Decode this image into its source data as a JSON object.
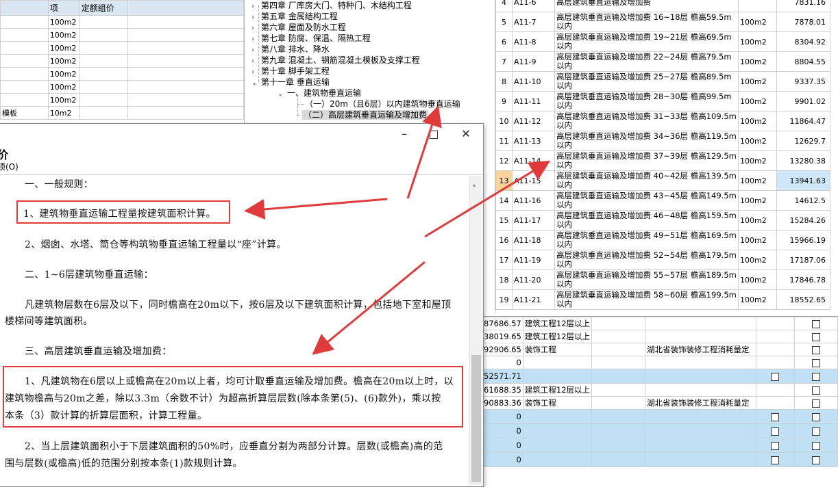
{
  "top_left_grid": {
    "headers": [
      "",
      "项",
      "定额组价"
    ],
    "rows": [
      {
        "name": "",
        "unit": "100m2"
      },
      {
        "name": "",
        "unit": "100m2"
      },
      {
        "name": "",
        "unit": "100m2"
      },
      {
        "name": "",
        "unit": "100m2"
      },
      {
        "name": "",
        "unit": "100m2"
      },
      {
        "name": "",
        "unit": "100m2"
      },
      {
        "name": "",
        "unit": "100m2"
      },
      {
        "name": "模板",
        "unit": "10m2"
      }
    ]
  },
  "tree": {
    "chapters": [
      "第四章  厂库房大门、特种门、木结构工程",
      "第五章  金属结构工程",
      "第六章  屋面及防水工程",
      "第七章  防腐、保温、隔热工程",
      "第八章  排水、降水",
      "第九章  混凝土、钢筋混凝土模板及支撑工程",
      "第十章  脚手架工程",
      "第十一章  垂直运输"
    ],
    "sub": "一、建筑物垂直运输",
    "leaf1": "（一）20m（且6层）以内建筑物垂直运输",
    "leaf2": "（二）高层建筑垂直运输及增加费"
  },
  "quota_table": {
    "rows": [
      {
        "num": "4",
        "code": "A11-6",
        "name": "高层建筑垂直运输及增加费",
        "unit": "",
        "price": "7831.16"
      },
      {
        "num": "5",
        "code": "A11-7",
        "name": "高层建筑垂直运输及增加费 16~18层 檐高59.5m以内",
        "unit": "100m2",
        "price": "7878.01"
      },
      {
        "num": "6",
        "code": "A11-8",
        "name": "高层建筑垂直运输及增加费 19~21层 檐高69.5m以内",
        "unit": "100m2",
        "price": "8304.92"
      },
      {
        "num": "7",
        "code": "A11-9",
        "name": "高层建筑垂直运输及增加费 22~24层 檐高79.5m以内",
        "unit": "100m2",
        "price": "8804.55"
      },
      {
        "num": "8",
        "code": "A11-10",
        "name": "高层建筑垂直运输及增加费 25~27层 檐高89.5m以内",
        "unit": "100m2",
        "price": "9337.35"
      },
      {
        "num": "9",
        "code": "A11-11",
        "name": "高层建筑垂直运输及增加费 28~30层 檐高99.5m以内",
        "unit": "100m2",
        "price": "9901.02"
      },
      {
        "num": "10",
        "code": "A11-12",
        "name": "高层建筑垂直运输及增加费 31~33层 檐高109.5m以内",
        "unit": "100m2",
        "price": "11864.47"
      },
      {
        "num": "11",
        "code": "A11-13",
        "name": "高层建筑垂直运输及增加费 34~36层 檐高119.5m以内",
        "unit": "100m2",
        "price": "12629.7"
      },
      {
        "num": "12",
        "code": "A11-14",
        "name": "高层建筑垂直运输及增加费 37~39层 檐高129.5m以内",
        "unit": "100m2",
        "price": "13280.38"
      },
      {
        "num": "13",
        "code": "A11-15",
        "name": "高层建筑垂直运输及增加费 40~42层 檐高139.5m以内",
        "unit": "100m2",
        "price": "13941.63"
      },
      {
        "num": "14",
        "code": "A11-16",
        "name": "高层建筑垂直运输及增加费 43~45层 檐高149.5m以内",
        "unit": "100m2",
        "price": "14612.5"
      },
      {
        "num": "15",
        "code": "A11-17",
        "name": "高层建筑垂直运输及增加费 46~48层 檐高159.5m以内",
        "unit": "100m2",
        "price": "15284.26"
      },
      {
        "num": "16",
        "code": "A11-18",
        "name": "高层建筑垂直运输及增加费 49~51层 檐高169.5m以内",
        "unit": "100m2",
        "price": "15966.19"
      },
      {
        "num": "17",
        "code": "A11-19",
        "name": "高层建筑垂直运输及增加费 52~54层 檐高179.5m以内",
        "unit": "100m2",
        "price": "17187.06"
      },
      {
        "num": "18",
        "code": "A11-20",
        "name": "高层建筑垂直运输及增加费 55~57层 檐高189.5m以内",
        "unit": "100m2",
        "price": "17846.78"
      },
      {
        "num": "19",
        "code": "A11-21",
        "name": "高层建筑垂直运输及增加费 58~60层 檐高199.5m以内",
        "unit": "100m2",
        "price": "18552.65"
      }
    ],
    "selected_num": "13"
  },
  "bottom_grid": {
    "rows": [
      {
        "amount": "87686.57",
        "type": "建筑工程12层以上",
        "std": "",
        "blue": false
      },
      {
        "amount": "38019.65",
        "type": "建筑工程12层以上",
        "std": "",
        "blue": false
      },
      {
        "amount": "92906.65",
        "type": "装饰工程",
        "std": "湖北省装饰装修工程消耗量定",
        "blue": false
      },
      {
        "amount": "0",
        "type": "",
        "std": "",
        "blue": false
      },
      {
        "amount": "52571.71",
        "type": "",
        "std": "",
        "blue": true
      },
      {
        "amount": "61688.35",
        "type": "建筑工程12层以上",
        "std": "",
        "blue": false
      },
      {
        "amount": "90883.36",
        "type": "装饰工程",
        "std": "湖北省装饰装修工程消耗量定",
        "blue": false
      },
      {
        "amount": "0",
        "type": "",
        "std": "",
        "blue": true
      },
      {
        "amount": "0",
        "type": "",
        "std": "",
        "blue": true
      },
      {
        "amount": "0",
        "type": "",
        "std": "",
        "blue": true
      },
      {
        "amount": "0",
        "type": "",
        "std": "",
        "blue": true
      }
    ]
  },
  "popup": {
    "toolbar_label_1": "价",
    "toolbar_label_2": "项(O)",
    "minimize": "–",
    "maximize": "□",
    "close": "✕",
    "p1": "一、一般规则：",
    "p2": "1、建筑物垂直运输工程量按建筑面积计算。",
    "p3": "2、烟囱、水塔、筒仓等构筑物垂直运输工程量以“座”计算。",
    "p4": "二、1~6层建筑物垂直运输：",
    "p5a": "凡建筑物层数在6层及以下，同时檐高在20m以下，按6层及以下建筑面积计算，包括地下室和屋顶",
    "p5b": "楼梯间等建筑面积。",
    "p6": "三、高层建筑垂直运输及增加费：",
    "p7a": "1、凡建筑物在6层以上或檐高在20m以上者，均可计取垂直运输及增加费。檐高在20m以上时，以",
    "p7b": "建筑物檐高与20m之差，除以3.3m（余数不计）为超高折算层层数(除本条第(5)、(6)款外)，乘以按",
    "p7c": "本条（3）款计算的折算层面积，计算工程量。",
    "p8a": "2、当上层建筑面积小于下层建筑面积的50%时，应垂直分割为两部分计算。层数(或檐高)高的范",
    "p8b": "围与层数(或檐高)低的范围分别按本条(1)款规则计算。"
  },
  "colors": {
    "annotation_red": "#e03a3a",
    "selected_orange": "#fbd49a",
    "selected_blue": "#cfe7fb",
    "row_blue": "#bfe0f5"
  }
}
